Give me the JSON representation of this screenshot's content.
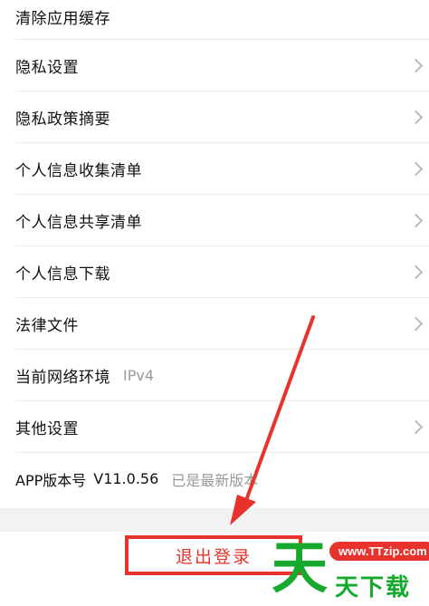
{
  "settings": {
    "clear_cache": "清除应用缓存",
    "privacy_settings": "隐私设置",
    "privacy_policy_summary": "隐私政策摘要",
    "personal_info_collection": "个人信息收集清单",
    "personal_info_sharing": "个人信息共享清单",
    "personal_info_download": "个人信息下载",
    "legal_documents": "法律文件",
    "network_env_label": "当前网络环境",
    "network_env_value": "IPv4",
    "other_settings": "其他设置",
    "version_label": "APP版本号",
    "version_number": "V11.0.56",
    "version_status": "已是最新版本"
  },
  "logout": {
    "label": "退出登录"
  },
  "watermark": {
    "logo_char": "天",
    "url": "www.TTzip.com",
    "name": "天下载"
  },
  "colors": {
    "accent_red": "#e8322d",
    "watermark_green": "#16a92e",
    "secondary_text": "#9a9a9a"
  }
}
